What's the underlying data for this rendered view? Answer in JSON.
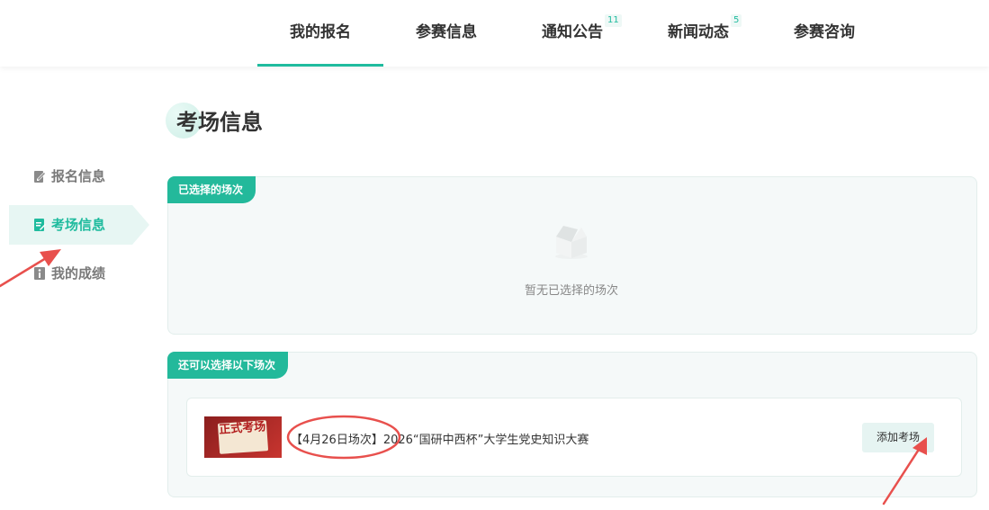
{
  "nav": {
    "items": [
      {
        "label": "我的报名",
        "badge": ""
      },
      {
        "label": "参赛信息",
        "badge": ""
      },
      {
        "label": "通知公告",
        "badge": "11"
      },
      {
        "label": "新闻动态",
        "badge": "5"
      },
      {
        "label": "参赛咨询",
        "badge": ""
      }
    ],
    "active_color": "#1fbb9e"
  },
  "sidebar": {
    "items": [
      {
        "label": "报名信息",
        "icon": "edit-icon"
      },
      {
        "label": "考场信息",
        "icon": "document-icon"
      },
      {
        "label": "我的成绩",
        "icon": "info-icon"
      }
    ]
  },
  "page": {
    "title": "考场信息"
  },
  "selected_panel": {
    "tag": "已选择的场次",
    "empty_text": "暂无已选择的场次"
  },
  "available_panel": {
    "tag": "还可以选择以下场次",
    "sessions": [
      {
        "thumb_text": "正式考场",
        "title": "【4月26日场次】2026“国研中西杯”大学生党史知识大赛",
        "button": "添加考场"
      }
    ]
  },
  "annotation_color": "#e8504d"
}
